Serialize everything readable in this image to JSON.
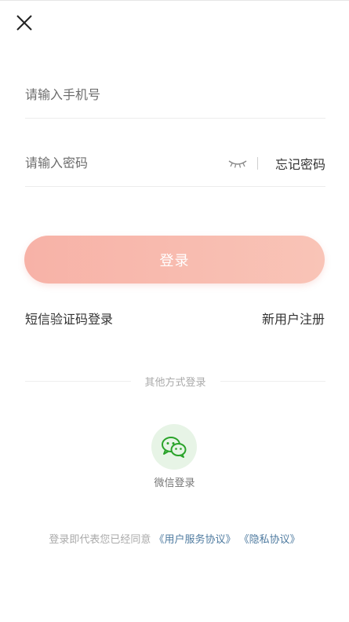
{
  "header": {
    "close_icon": "close-icon"
  },
  "form": {
    "phone_placeholder": "请输入手机号",
    "password_placeholder": "请输入密码",
    "eye_icon": "eye-closed-icon",
    "forgot_password": "忘记密码"
  },
  "login_button": {
    "label": "登录",
    "color_start": "#f7b2a7",
    "color_end": "#f9c4b7"
  },
  "links": {
    "sms_login": "短信验证码登录",
    "new_user_register": "新用户注册"
  },
  "other_login": {
    "title": "其他方式登录",
    "wechat_icon": "wechat-icon",
    "wechat_label": "微信登录",
    "wechat_color": "#2aa32a"
  },
  "agreement": {
    "prefix": "登录即代表您已经同意",
    "user_agreement": "《用户服务协议》",
    "privacy_policy": "《隐私协议》"
  }
}
